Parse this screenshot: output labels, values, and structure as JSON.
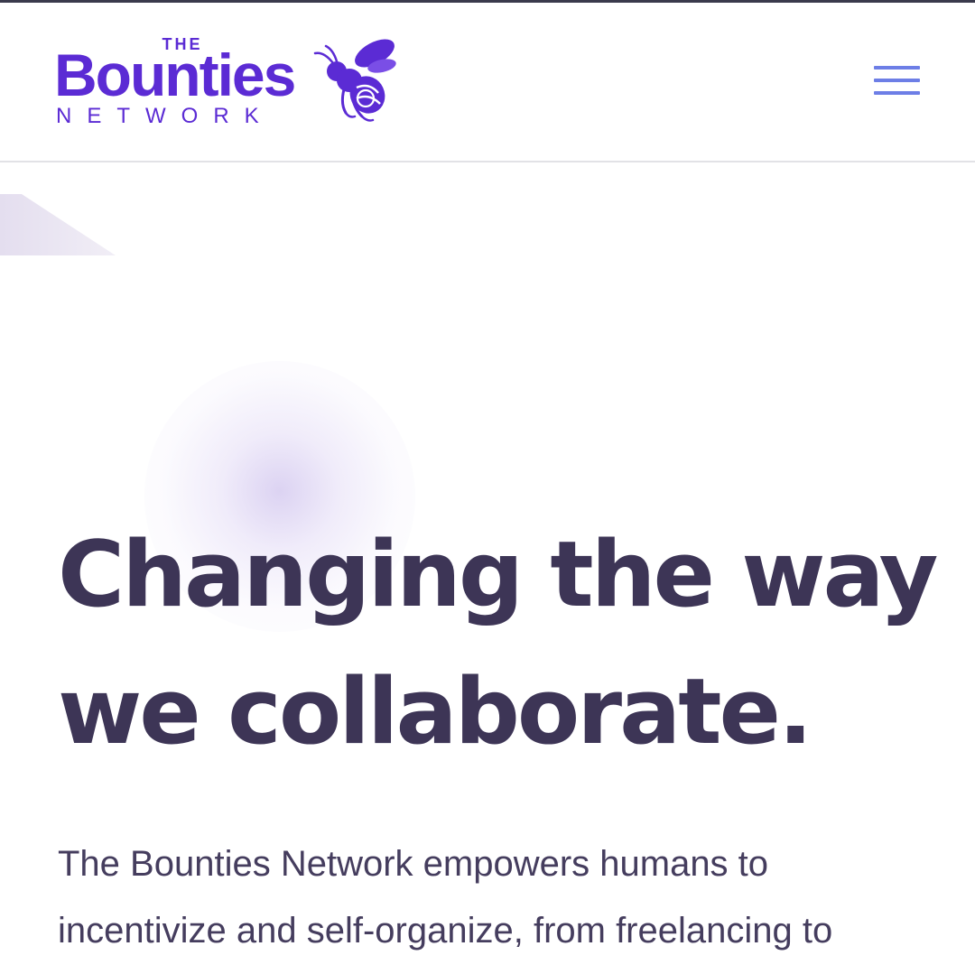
{
  "header": {
    "logo": {
      "the": "THE",
      "name": "Bounties",
      "network": "NETWORK",
      "mascot_icon": "bee-icon"
    },
    "menu_icon": "hamburger-menu-icon"
  },
  "hero": {
    "title": "Changing the way we collaborate.",
    "description": "The Bounties Network empowers humans to incentivize and self-organize, from freelancing to"
  },
  "colors": {
    "brand_purple": "#5b2bd4",
    "menu_blue": "#6d7ee6",
    "heading_text": "#3d3556",
    "body_text": "#453d5e"
  }
}
